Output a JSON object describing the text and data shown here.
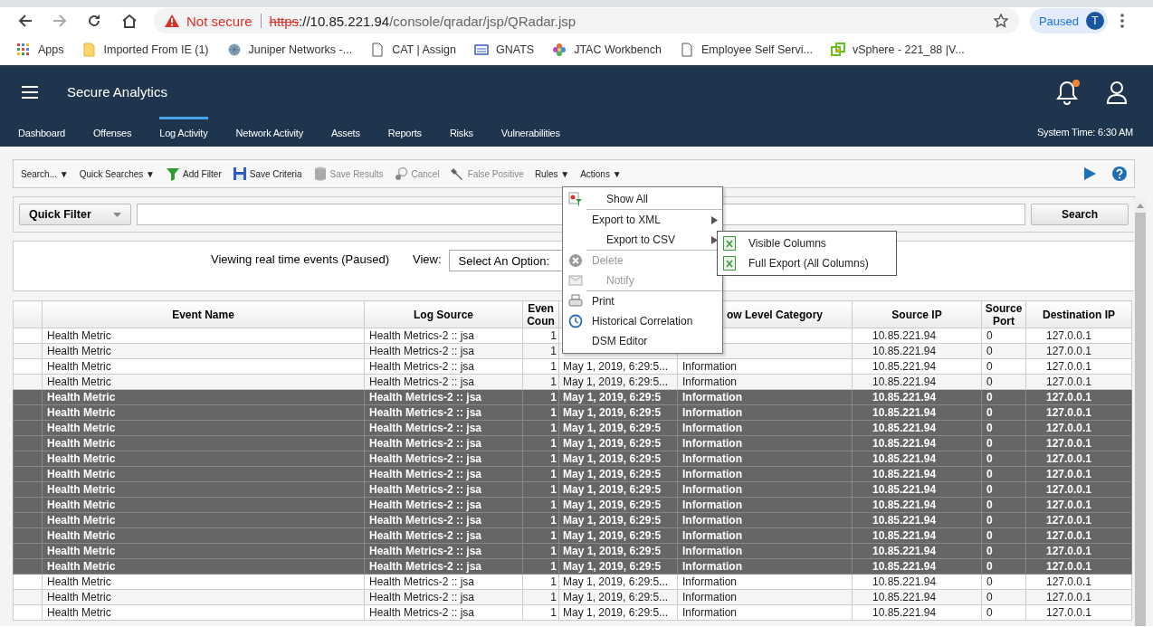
{
  "browser": {
    "security": "Not secure",
    "url_scheme": "https",
    "url_host": "://10.85.221.94",
    "url_path": "/console/qradar/jsp/QRadar.jsp",
    "profile_status": "Paused",
    "profile_initial": "T",
    "bookmarks": [
      {
        "kind": "apps",
        "label": "Apps"
      },
      {
        "kind": "folder",
        "label": "Imported From IE (1)"
      },
      {
        "kind": "globe",
        "label": "Juniper Networks -..."
      },
      {
        "kind": "page",
        "label": "CAT | Assign"
      },
      {
        "kind": "badge",
        "label": "GNATS"
      },
      {
        "kind": "flower",
        "label": "JTAC Workbench"
      },
      {
        "kind": "page",
        "label": "Employee Self Servi..."
      },
      {
        "kind": "vsphere",
        "label": "vSphere - 221_88 |V..."
      }
    ]
  },
  "app": {
    "title": "Secure Analytics",
    "nav": [
      {
        "label": "Dashboard",
        "selected": false
      },
      {
        "label": "Offenses",
        "selected": false
      },
      {
        "label": "Log Activity",
        "selected": true
      },
      {
        "label": "Network Activity",
        "selected": false
      },
      {
        "label": "Assets",
        "selected": false
      },
      {
        "label": "Reports",
        "selected": false
      },
      {
        "label": "Risks",
        "selected": false
      },
      {
        "label": "Vulnerabilities",
        "selected": false
      }
    ],
    "system_time": "System Time: 6:30 AM"
  },
  "toolbar": [
    {
      "kind": "dropdown",
      "label": "Search... ▼",
      "disabled": false
    },
    {
      "kind": "dropdown",
      "label": "Quick Searches ▼",
      "disabled": false
    },
    {
      "kind": "funnel",
      "label": "Add Filter",
      "disabled": false
    },
    {
      "kind": "floppy",
      "label": "Save Criteria",
      "disabled": false
    },
    {
      "kind": "database",
      "label": "Save Results",
      "disabled": true
    },
    {
      "kind": "cancel",
      "label": "Cancel",
      "disabled": true
    },
    {
      "kind": "wrench",
      "label": "False Positive",
      "disabled": true
    },
    {
      "kind": "dropdown",
      "label": "Rules ▼",
      "disabled": false
    },
    {
      "kind": "dropdown",
      "label": "Actions ▼",
      "disabled": false
    }
  ],
  "filter": {
    "quick_filter": "Quick Filter",
    "search_button": "Search"
  },
  "status": {
    "message": "Viewing real time events (Paused)",
    "view_label": "View:",
    "view_select": "Select An Option:"
  },
  "actions_menu": [
    {
      "kind": "showall",
      "label": "Show All",
      "disabled": false,
      "submenu": false,
      "divider_after": true
    },
    {
      "kind": "none",
      "label": "Export to XML",
      "disabled": false,
      "submenu": true,
      "divider_after": false
    },
    {
      "kind": "none",
      "label": "Export to CSV",
      "disabled": false,
      "submenu": true,
      "divider_after": true
    },
    {
      "kind": "delete",
      "label": "Delete",
      "disabled": true,
      "submenu": false,
      "divider_after": false
    },
    {
      "kind": "mail",
      "label": "Notify",
      "disabled": true,
      "submenu": false,
      "divider_after": true
    },
    {
      "kind": "print",
      "label": "Print",
      "disabled": false,
      "submenu": false,
      "divider_after": false
    },
    {
      "kind": "clock",
      "label": "Historical Correlation",
      "disabled": false,
      "submenu": false,
      "divider_after": false
    },
    {
      "kind": "none",
      "label": "DSM Editor",
      "disabled": false,
      "submenu": false,
      "divider_after": false
    }
  ],
  "csv_submenu": [
    "Visible Columns",
    "Full Export (All Columns)"
  ],
  "table": {
    "columns": {
      "event_name": "Event Name",
      "log_source": "Log Source",
      "event_count": "Even Coun",
      "low_level_category": "ow Level Category",
      "source_ip": "Source IP",
      "source_port": "Source Port",
      "destination_ip": "Destination IP"
    },
    "rows": [
      {
        "selected": false,
        "event_name": "Health Metric",
        "log_source": "Health Metrics-2 :: jsa",
        "event_count": "1",
        "source_ip": "10.85.221.94",
        "source_port": "0",
        "destination_ip": "127.0.0.1"
      },
      {
        "selected": false,
        "event_name": "Health Metric",
        "log_source": "Health Metrics-2 :: jsa",
        "event_count": "1",
        "source_ip": "10.85.221.94",
        "source_port": "0",
        "destination_ip": "127.0.0.1"
      },
      {
        "selected": false,
        "event_name": "Health Metric",
        "log_source": "Health Metrics-2 :: jsa",
        "event_count": "1",
        "start_time": "May 1, 2019, 6:29:5...",
        "low_level_category": "Information",
        "source_ip": "10.85.221.94",
        "source_port": "0",
        "destination_ip": "127.0.0.1"
      },
      {
        "selected": false,
        "event_name": "Health Metric",
        "log_source": "Health Metrics-2 :: jsa",
        "event_count": "1",
        "start_time": "May 1, 2019, 6:29:5...",
        "low_level_category": "Information",
        "source_ip": "10.85.221.94",
        "source_port": "0",
        "destination_ip": "127.0.0.1"
      },
      {
        "selected": true,
        "event_name": "Health Metric",
        "log_source": "Health Metrics-2 :: jsa",
        "event_count": "1",
        "start_time": "May 1, 2019, 6:29:5",
        "low_level_category": "Information",
        "source_ip": "10.85.221.94",
        "source_port": "0",
        "destination_ip": "127.0.0.1"
      },
      {
        "selected": true,
        "event_name": "Health Metric",
        "log_source": "Health Metrics-2 :: jsa",
        "event_count": "1",
        "start_time": "May 1, 2019, 6:29:5",
        "low_level_category": "Information",
        "source_ip": "10.85.221.94",
        "source_port": "0",
        "destination_ip": "127.0.0.1"
      },
      {
        "selected": true,
        "event_name": "Health Metric",
        "log_source": "Health Metrics-2 :: jsa",
        "event_count": "1",
        "start_time": "May 1, 2019, 6:29:5",
        "low_level_category": "Information",
        "source_ip": "10.85.221.94",
        "source_port": "0",
        "destination_ip": "127.0.0.1"
      },
      {
        "selected": true,
        "event_name": "Health Metric",
        "log_source": "Health Metrics-2 :: jsa",
        "event_count": "1",
        "start_time": "May 1, 2019, 6:29:5",
        "low_level_category": "Information",
        "source_ip": "10.85.221.94",
        "source_port": "0",
        "destination_ip": "127.0.0.1"
      },
      {
        "selected": true,
        "event_name": "Health Metric",
        "log_source": "Health Metrics-2 :: jsa",
        "event_count": "1",
        "start_time": "May 1, 2019, 6:29:5",
        "low_level_category": "Information",
        "source_ip": "10.85.221.94",
        "source_port": "0",
        "destination_ip": "127.0.0.1"
      },
      {
        "selected": true,
        "event_name": "Health Metric",
        "log_source": "Health Metrics-2 :: jsa",
        "event_count": "1",
        "start_time": "May 1, 2019, 6:29:5",
        "low_level_category": "Information",
        "source_ip": "10.85.221.94",
        "source_port": "0",
        "destination_ip": "127.0.0.1"
      },
      {
        "selected": true,
        "event_name": "Health Metric",
        "log_source": "Health Metrics-2 :: jsa",
        "event_count": "1",
        "start_time": "May 1, 2019, 6:29:5",
        "low_level_category": "Information",
        "source_ip": "10.85.221.94",
        "source_port": "0",
        "destination_ip": "127.0.0.1"
      },
      {
        "selected": true,
        "event_name": "Health Metric",
        "log_source": "Health Metrics-2 :: jsa",
        "event_count": "1",
        "start_time": "May 1, 2019, 6:29:5",
        "low_level_category": "Information",
        "source_ip": "10.85.221.94",
        "source_port": "0",
        "destination_ip": "127.0.0.1"
      },
      {
        "selected": true,
        "event_name": "Health Metric",
        "log_source": "Health Metrics-2 :: jsa",
        "event_count": "1",
        "start_time": "May 1, 2019, 6:29:5",
        "low_level_category": "Information",
        "source_ip": "10.85.221.94",
        "source_port": "0",
        "destination_ip": "127.0.0.1"
      },
      {
        "selected": true,
        "event_name": "Health Metric",
        "log_source": "Health Metrics-2 :: jsa",
        "event_count": "1",
        "start_time": "May 1, 2019, 6:29:5",
        "low_level_category": "Information",
        "source_ip": "10.85.221.94",
        "source_port": "0",
        "destination_ip": "127.0.0.1"
      },
      {
        "selected": true,
        "event_name": "Health Metric",
        "log_source": "Health Metrics-2 :: jsa",
        "event_count": "1",
        "start_time": "May 1, 2019, 6:29:5",
        "low_level_category": "Information",
        "source_ip": "10.85.221.94",
        "source_port": "0",
        "destination_ip": "127.0.0.1"
      },
      {
        "selected": true,
        "event_name": "Health Metric",
        "log_source": "Health Metrics-2 :: jsa",
        "event_count": "1",
        "start_time": "May 1, 2019, 6:29:5",
        "low_level_category": "Information",
        "source_ip": "10.85.221.94",
        "source_port": "0",
        "destination_ip": "127.0.0.1"
      },
      {
        "selected": false,
        "event_name": "Health Metric",
        "log_source": "Health Metrics-2 :: jsa",
        "event_count": "1",
        "start_time": "May 1, 2019, 6:29:5...",
        "low_level_category": "Information",
        "source_ip": "10.85.221.94",
        "source_port": "0",
        "destination_ip": "127.0.0.1"
      },
      {
        "selected": false,
        "event_name": "Health Metric",
        "log_source": "Health Metrics-2 :: jsa",
        "event_count": "1",
        "start_time": "May 1, 2019, 6:29:5...",
        "low_level_category": "Information",
        "source_ip": "10.85.221.94",
        "source_port": "0",
        "destination_ip": "127.0.0.1"
      },
      {
        "selected": false,
        "event_name": "Health Metric",
        "log_source": "Health Metrics-2 :: jsa",
        "event_count": "1",
        "start_time": "May 1, 2019, 6:29:5...",
        "low_level_category": "Information",
        "source_ip": "10.85.221.94",
        "source_port": "0",
        "destination_ip": "127.0.0.1"
      }
    ]
  }
}
